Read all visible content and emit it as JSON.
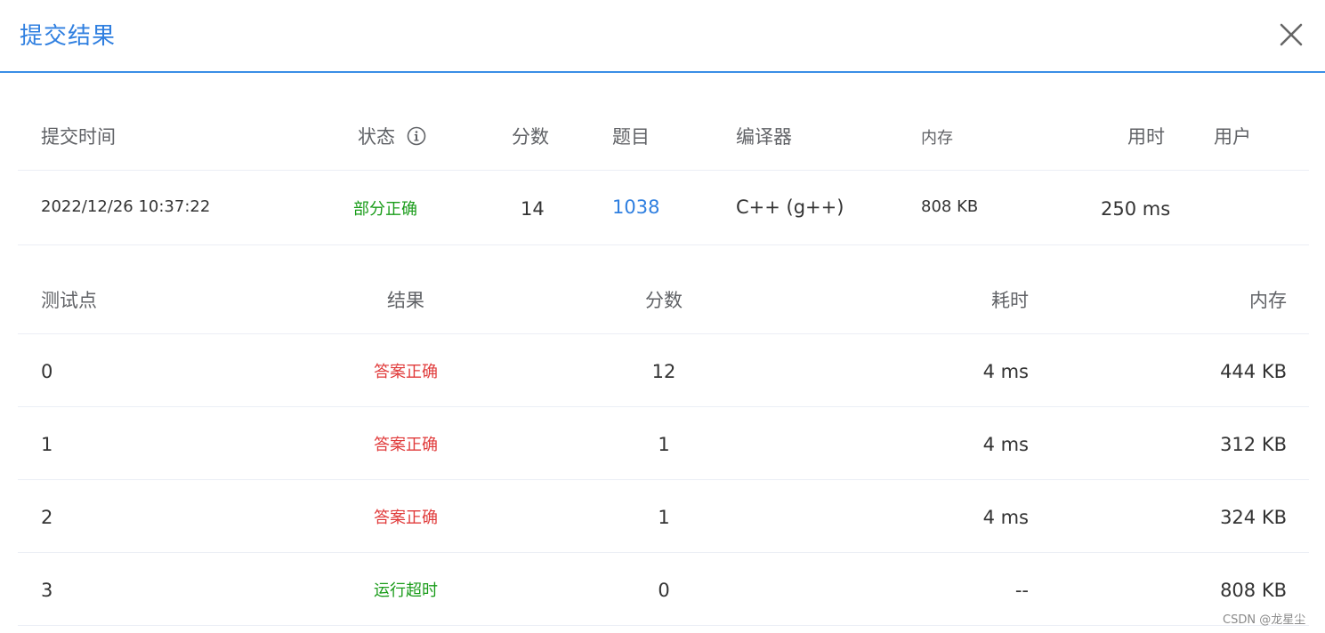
{
  "dialog": {
    "title": "提交结果"
  },
  "summary": {
    "headers": {
      "submit_time": "提交时间",
      "status": "状态",
      "score": "分数",
      "problem": "题目",
      "compiler": "编译器",
      "memory": "内存",
      "time": "用时",
      "user": "用户"
    },
    "row": {
      "submit_time": "2022/12/26 10:37:22",
      "status": "部分正确",
      "score": "14",
      "problem": "1038",
      "compiler": "C++ (g++)",
      "memory": "808 KB",
      "time": "250 ms",
      "user": ""
    }
  },
  "testcases": {
    "headers": {
      "case": "测试点",
      "result": "结果",
      "score": "分数",
      "time": "耗时",
      "memory": "内存"
    },
    "rows": [
      {
        "case": "0",
        "result": "答案正确",
        "score": "12",
        "time": "4 ms",
        "memory": "444 KB"
      },
      {
        "case": "1",
        "result": "答案正确",
        "score": "1",
        "time": "4 ms",
        "memory": "312 KB"
      },
      {
        "case": "2",
        "result": "答案正确",
        "score": "1",
        "time": "4 ms",
        "memory": "324 KB"
      },
      {
        "case": "3",
        "result": "运行超时",
        "score": "0",
        "time": "--",
        "memory": "808 KB"
      }
    ]
  },
  "watermark": "CSDN @龙星尘",
  "colors": {
    "accent": "#2f7fe0",
    "success": "#1a9c1a",
    "error": "#e03a3a"
  },
  "icons": {
    "close": "close-icon",
    "status_info": "info-circle-icon"
  }
}
